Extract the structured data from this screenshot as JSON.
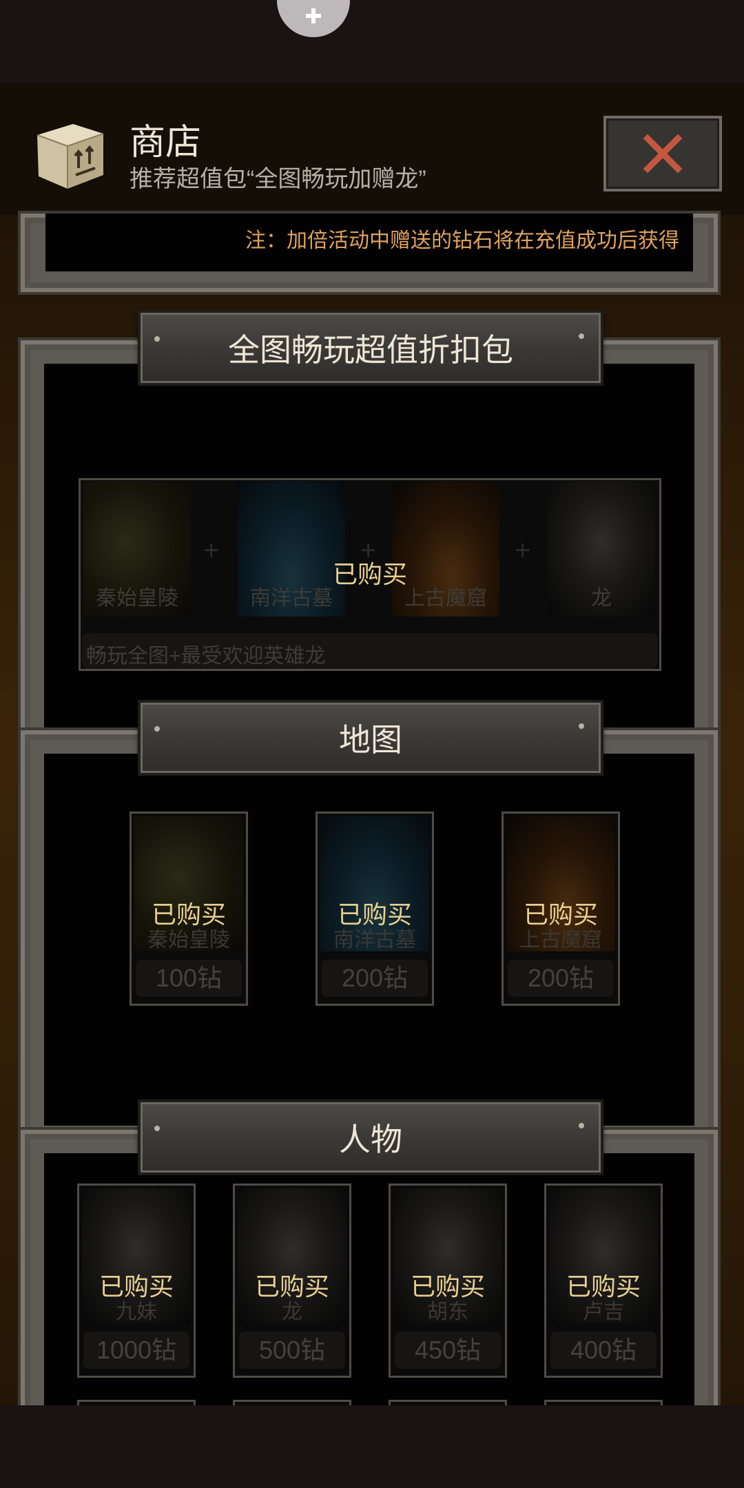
{
  "header": {
    "title": "商店",
    "subtitle": "推荐超值包“全图畅玩加赠龙”"
  },
  "note": "注：加倍活动中赠送的钻石将在充值成功后获得",
  "bundle_section": {
    "title": "全图畅玩超值折扣包",
    "items": [
      "秦始皇陵",
      "南洋古墓",
      "上古魔窟",
      "龙"
    ],
    "plus": "+",
    "description": "畅玩全图+最受欢迎英雄龙",
    "status": "已购买"
  },
  "map_section": {
    "title": "地图",
    "items": [
      {
        "name": "秦始皇陵",
        "status": "已购买",
        "price": "100钻"
      },
      {
        "name": "南洋古墓",
        "status": "已购买",
        "price": "200钻"
      },
      {
        "name": "上古魔窟",
        "status": "已购买",
        "price": "200钻"
      }
    ]
  },
  "character_section": {
    "title": "人物",
    "items": [
      {
        "name": "九妹",
        "status": "已购买",
        "price": "1000钻"
      },
      {
        "name": "龙",
        "status": "已购买",
        "price": "500钻"
      },
      {
        "name": "胡东",
        "status": "已购买",
        "price": "450钻"
      },
      {
        "name": "卢吉",
        "status": "已购买",
        "price": "400钻"
      }
    ]
  },
  "icons": {
    "close": "close-icon",
    "box": "box-icon",
    "puzzle": "puzzle-icon"
  },
  "colors": {
    "accent_gold": "#e8cf8f",
    "note_orange": "#e0a25e",
    "close_red": "#c4573f"
  }
}
